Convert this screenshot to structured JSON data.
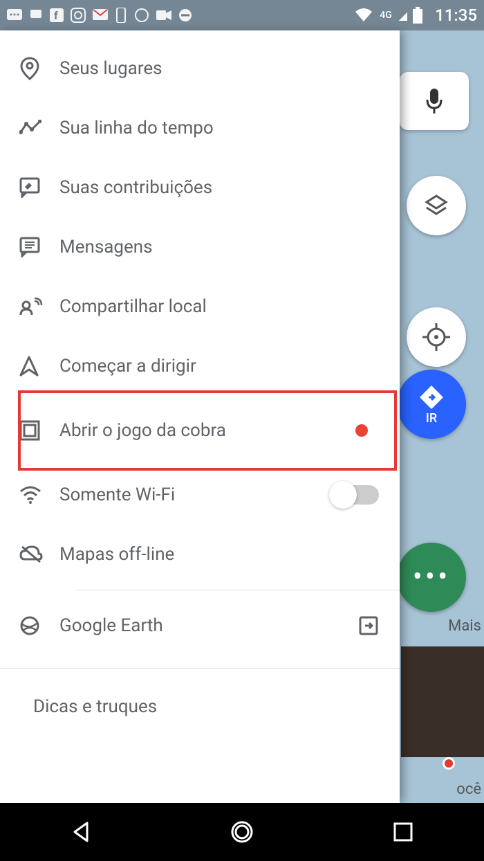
{
  "status": {
    "time": "11:35",
    "network": "4G"
  },
  "drawer": {
    "items": [
      {
        "label": "Seus lugares"
      },
      {
        "label": "Sua linha do tempo"
      },
      {
        "label": "Suas contribuições"
      },
      {
        "label": "Mensagens"
      },
      {
        "label": "Compartilhar local"
      },
      {
        "label": "Começar a dirigir"
      },
      {
        "label": "Abrir o jogo da cobra"
      },
      {
        "label": "Somente Wi-Fi"
      },
      {
        "label": "Mapas off-line"
      },
      {
        "label": "Google Earth"
      }
    ],
    "section_title": "Dicas e truques"
  },
  "map": {
    "go_label": "IR",
    "more_label": "Mais",
    "chip2": "ocê"
  }
}
